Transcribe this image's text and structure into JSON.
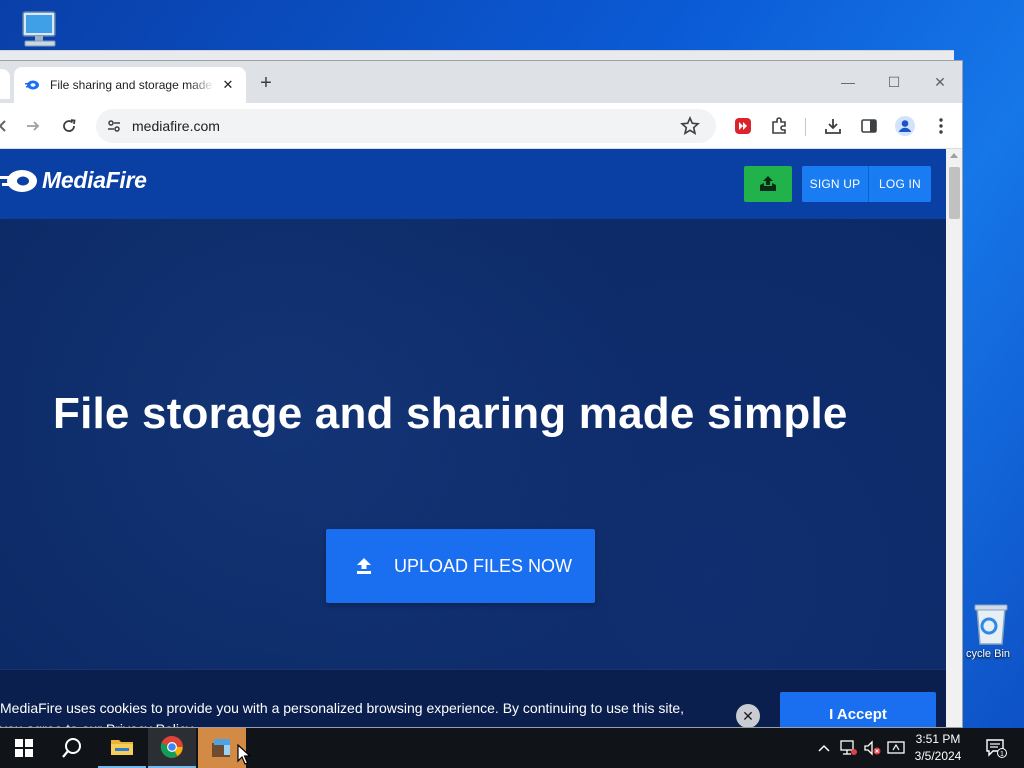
{
  "desktop": {
    "icons": [
      {
        "name": "This PC",
        "label": ""
      },
      {
        "name": "Recycle Bin",
        "label": "cycle Bin"
      }
    ]
  },
  "browser": {
    "tab": {
      "title": "File sharing and storage made simple",
      "close": "✕"
    },
    "new_tab": "+",
    "window_controls": {
      "minimize": "—",
      "maximize": "☐",
      "close": "✕"
    },
    "address": {
      "url": "mediafire.com"
    },
    "toolbar_icons": [
      "back-icon",
      "forward-icon",
      "reload-icon",
      "site-info-icon",
      "star-icon",
      "extension-icon",
      "puzzle-icon",
      "download-icon",
      "side-panel-icon",
      "profile-icon",
      "menu-icon"
    ]
  },
  "page": {
    "logo": "MediaFire",
    "header_buttons": {
      "signup": "SIGN UP",
      "login": "LOG IN"
    },
    "hero_title": "File storage and sharing made simple",
    "upload_button": "UPLOAD FILES NOW",
    "cookie": {
      "text": "MediaFire uses cookies to provide you with a personalized browsing experience. By continuing to use this site, you agree to our Privacy Policy.",
      "accept": "I Accept",
      "close": "✕"
    },
    "colors": {
      "header": "#0a3fa4",
      "hero": "#0c2a66",
      "primary_button": "#1a6ff0",
      "green_button": "#22b24c"
    }
  },
  "taskbar": {
    "clock": {
      "time": "3:51 PM",
      "date": "3/5/2024"
    },
    "notification_count": "1",
    "pinned": [
      "start-icon",
      "search-icon",
      "file-explorer-icon",
      "chrome-icon",
      "app-icon"
    ]
  }
}
